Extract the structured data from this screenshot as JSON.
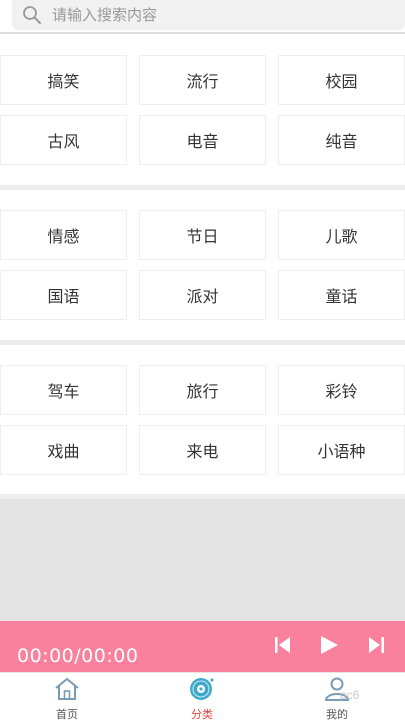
{
  "search": {
    "placeholder": "请输入搜索内容"
  },
  "sections": [
    {
      "rows": [
        [
          "搞笑",
          "流行",
          "校园"
        ],
        [
          "古风",
          "电音",
          "纯音"
        ]
      ]
    },
    {
      "rows": [
        [
          "情感",
          "节日",
          "儿歌"
        ],
        [
          "国语",
          "派对",
          "童话"
        ]
      ]
    },
    {
      "rows": [
        [
          "驾车",
          "旅行",
          "彩铃"
        ],
        [
          "戏曲",
          "来电",
          "小语种"
        ]
      ]
    }
  ],
  "player": {
    "time_display": "00:00/00:00",
    "controls": [
      "prev-icon",
      "play-icon",
      "next-icon"
    ]
  },
  "tabs": [
    {
      "label": "首页",
      "icon": "home-icon",
      "active": false
    },
    {
      "label": "分类",
      "icon": "disc-icon",
      "active": true
    },
    {
      "label": "我的",
      "icon": "user-icon",
      "active": false
    }
  ],
  "colors": {
    "accent": "#f9819d",
    "active_tab": "#e4463c",
    "divider": "#ececec",
    "empty_area": "#e3e3e3"
  },
  "watermark": "pc6"
}
